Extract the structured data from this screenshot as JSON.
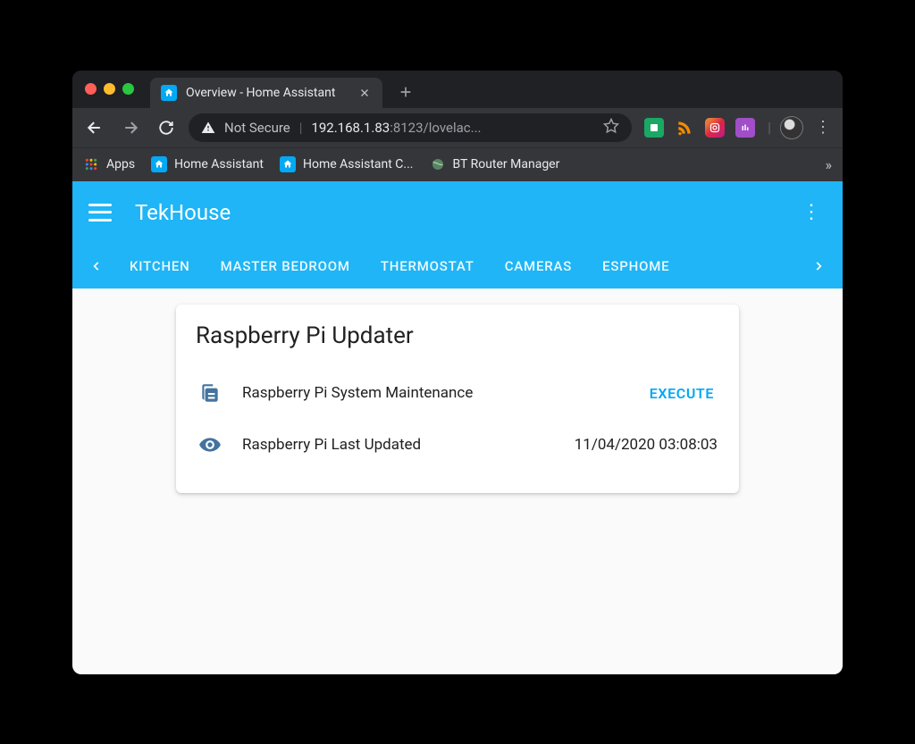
{
  "browser": {
    "tab_title": "Overview - Home Assistant",
    "not_secure_label": "Not Secure",
    "url_host": "192.168.1.83",
    "url_port": ":8123",
    "url_path": "/lovelac...",
    "bookmarks": {
      "apps": "Apps",
      "items": [
        {
          "label": "Home Assistant"
        },
        {
          "label": "Home Assistant C..."
        },
        {
          "label": "BT Router Manager"
        }
      ]
    }
  },
  "ha": {
    "title": "TekHouse",
    "tabs": [
      "KITCHEN",
      "MASTER BEDROOM",
      "THERMOSTAT",
      "CAMERAS",
      "ESPHOME"
    ],
    "card": {
      "title": "Raspberry Pi Updater",
      "rows": [
        {
          "label": "Raspberry Pi System Maintenance",
          "action": "EXECUTE"
        },
        {
          "label": "Raspberry Pi Last Updated",
          "value": "11/04/2020 03:08:03"
        }
      ]
    }
  }
}
